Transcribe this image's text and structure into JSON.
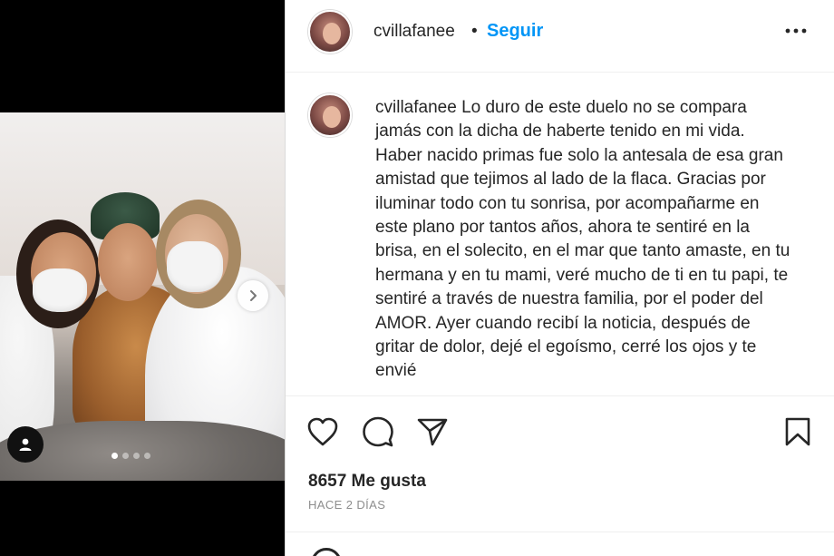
{
  "post": {
    "username": "cvillafanee",
    "separator": "•",
    "follow_label": "Seguir",
    "caption": "Lo duro de este duelo no se compara jamás con la dicha de haberte tenido en mi vida. Haber nacido primas fue solo la antesala de esa gran amistad que tejimos al lado de la flaca. Gracias por iluminar todo con tu sonrisa, por acompañarme en este plano por tantos años, ahora te sentiré en la brisa, en el solecito, en el mar que tanto amaste, en tu hermana y en tu mami, veré mucho de ti en tu papi, te sentiré a través de nuestra familia, por el poder del AMOR. Ayer cuando recibí la noticia, después de gritar de dolor, dejé el egoísmo, cerré los ojos y te envié",
    "likes": "8657 Me gusta",
    "timestamp": "HACE 2 DÍAS"
  },
  "carousel": {
    "total": 4,
    "current": 1
  },
  "icons": {
    "more": "more-options-icon",
    "like": "heart-icon",
    "comment": "comment-icon",
    "share": "send-icon",
    "save": "bookmark-icon",
    "next": "chevron-right-icon",
    "tag": "user-tag-icon"
  },
  "colors": {
    "accent": "#0095f6",
    "text": "#262626",
    "muted": "#8e8e8e"
  }
}
